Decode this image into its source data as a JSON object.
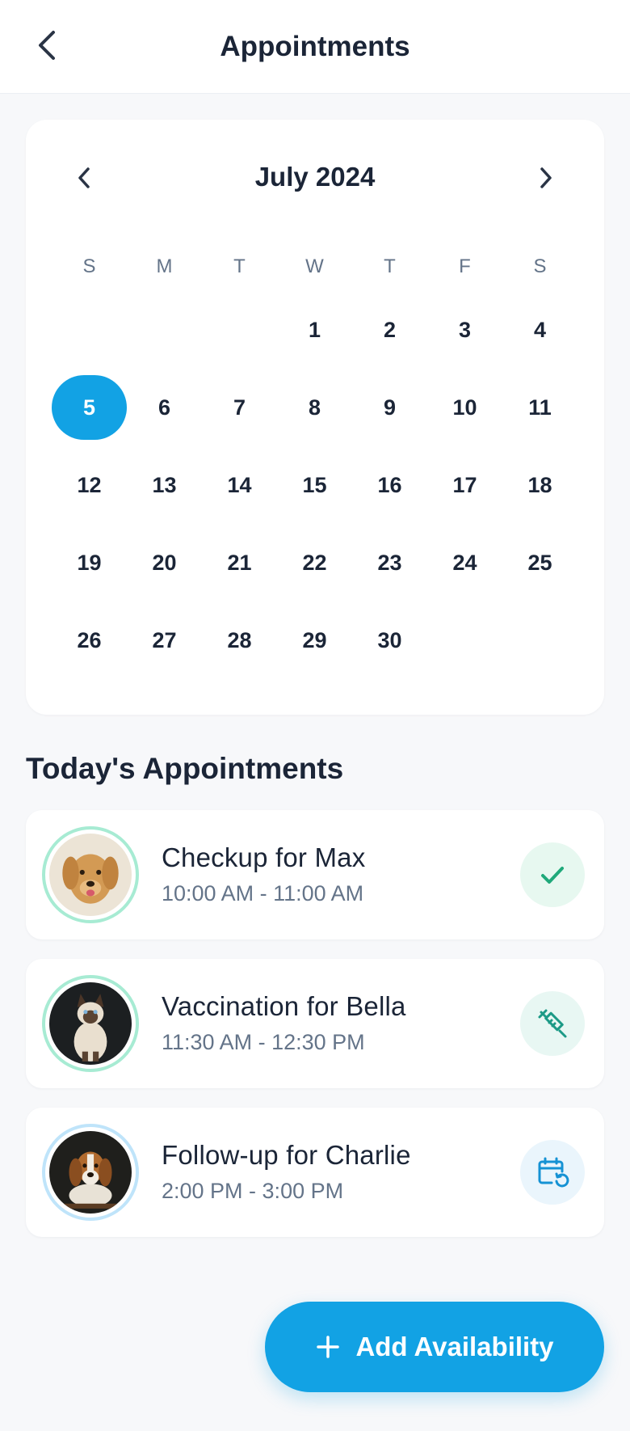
{
  "header": {
    "title": "Appointments",
    "back_icon": "chevron-left-icon"
  },
  "calendar": {
    "month_label": "July 2024",
    "prev_icon": "chevron-left-icon",
    "next_icon": "chevron-right-icon",
    "weekdays": [
      "S",
      "M",
      "T",
      "W",
      "T",
      "F",
      "S"
    ],
    "weeks": [
      [
        "",
        "",
        "",
        "1",
        "2",
        "3",
        "4"
      ],
      [
        "5",
        "6",
        "7",
        "8",
        "9",
        "10",
        "11"
      ],
      [
        "12",
        "13",
        "14",
        "15",
        "16",
        "17",
        "18"
      ],
      [
        "19",
        "20",
        "21",
        "22",
        "23",
        "24",
        "25"
      ],
      [
        "26",
        "27",
        "28",
        "29",
        "30",
        "",
        ""
      ]
    ],
    "selected_day": "5",
    "accent_color": "#12a2e4"
  },
  "appointments": {
    "title": "Today's Appointments",
    "items": [
      {
        "title": "Checkup for Max",
        "time": "10:00 AM - 11:00 AM",
        "status_icon": "check-icon",
        "avatar": "golden-retriever-photo"
      },
      {
        "title": "Vaccination for Bella",
        "time": "11:30 AM - 12:30 PM",
        "status_icon": "syringe-icon",
        "avatar": "siamese-cat-photo"
      },
      {
        "title": "Follow-up for Charlie",
        "time": "2:00 PM - 3:00 PM",
        "status_icon": "calendar-reschedule-icon",
        "avatar": "beagle-photo"
      }
    ]
  },
  "fab": {
    "label": "Add Availability",
    "icon": "plus-icon"
  }
}
